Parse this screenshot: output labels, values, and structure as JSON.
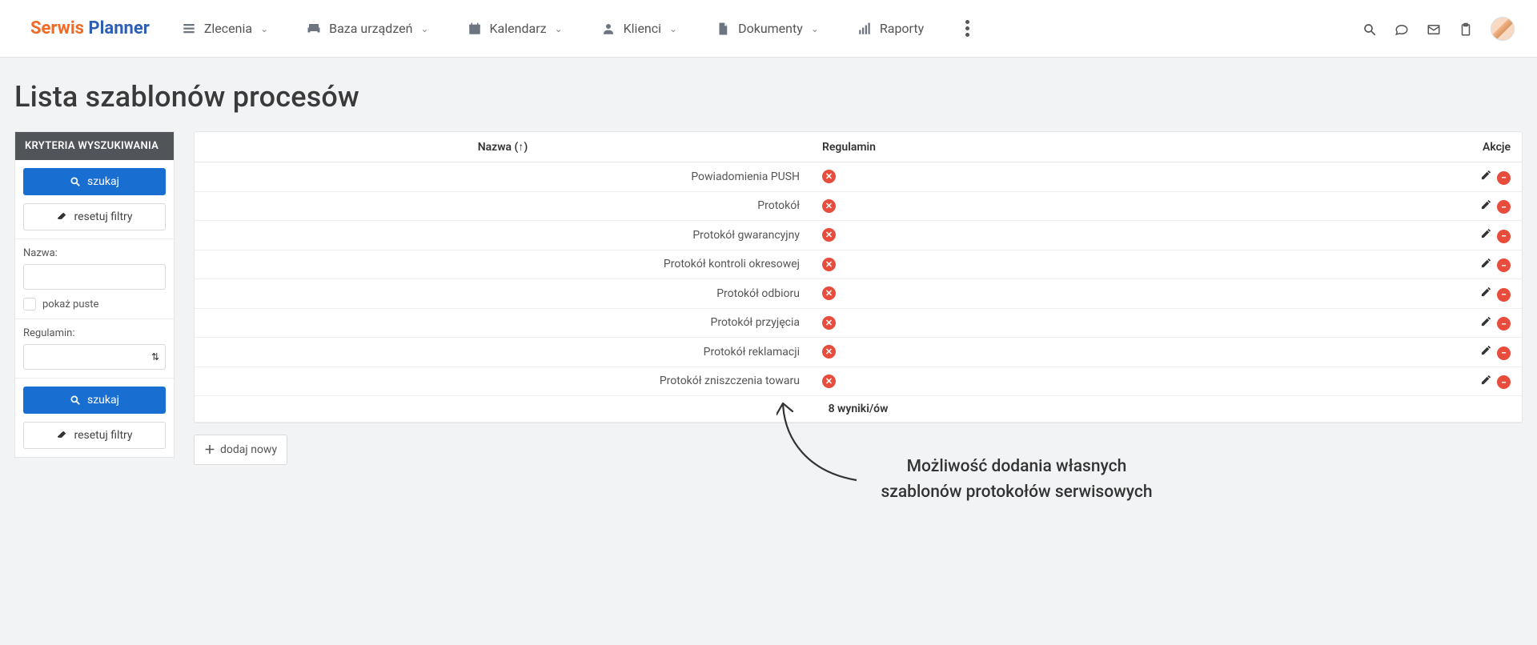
{
  "logo": {
    "w1": "Serwis",
    "w2": "Planner"
  },
  "nav": {
    "items": [
      {
        "label": "Zlecenia",
        "icon": "list-icon"
      },
      {
        "label": "Baza urządzeń",
        "icon": "printer-icon"
      },
      {
        "label": "Kalendarz",
        "icon": "calendar-icon"
      },
      {
        "label": "Klienci",
        "icon": "person-icon"
      },
      {
        "label": "Dokumenty",
        "icon": "document-icon"
      },
      {
        "label": "Raporty",
        "icon": "chart-icon"
      }
    ]
  },
  "page_title": "Lista szablonów procesów",
  "sidebar": {
    "header": "KRYTERIA WYSZUKIWANIA",
    "search_label": "szukaj",
    "reset_label": "resetuj filtry",
    "name_label": "Nazwa:",
    "show_empty_label": "pokaż puste",
    "regulation_label": "Regulamin:"
  },
  "table": {
    "columns": {
      "name": "Nazwa (↑)",
      "regulation": "Regulamin",
      "actions": "Akcje"
    },
    "rows": [
      {
        "name": "Powiadomienia PUSH"
      },
      {
        "name": "Protokół"
      },
      {
        "name": "Protokół gwarancyjny"
      },
      {
        "name": "Protokół kontroli okresowej"
      },
      {
        "name": "Protokół odbioru"
      },
      {
        "name": "Protokół przyjęcia"
      },
      {
        "name": "Protokół reklamacji"
      },
      {
        "name": "Protokół zniszczenia towaru"
      }
    ],
    "summary": "8 wyniki/ów"
  },
  "add_new_label": "dodaj nowy",
  "annotation": {
    "line1": "Możliwość dodania własnych",
    "line2": "szablonów protokołów serwisowych"
  }
}
